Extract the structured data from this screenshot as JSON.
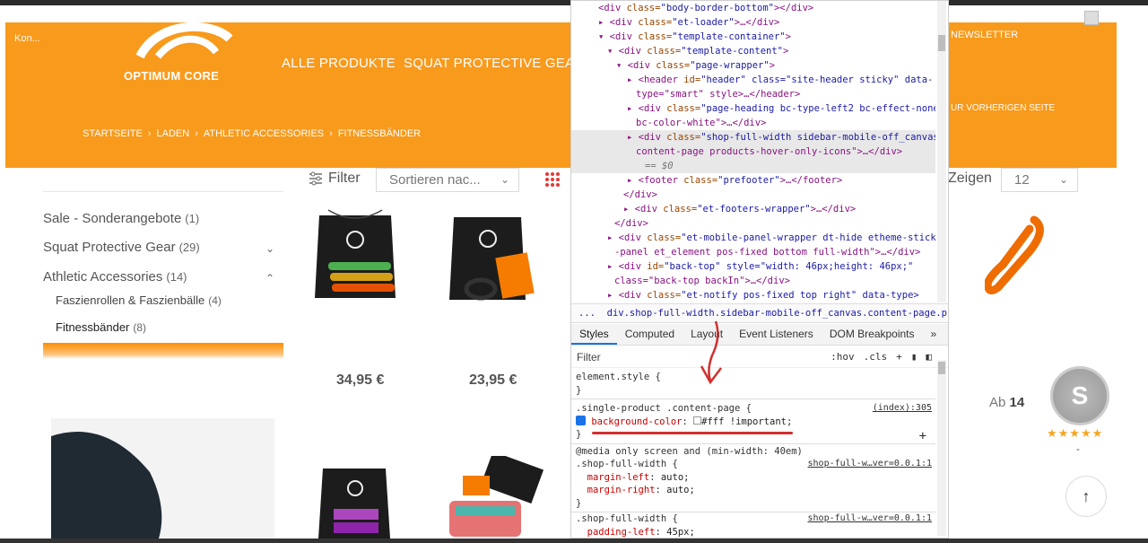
{
  "header": {
    "logo_text": "OPTIMUM CORE",
    "nav": [
      "ALLE PRODUKTE",
      "SQUAT PROTECTIVE GEAR"
    ],
    "top_left_small": "Kon...",
    "top_right_small": "...",
    "newsletter": "NEWSLETTER",
    "back_link": "UR VORHERIGEN SEITE",
    "breadcrumbs": [
      "STARTSEITE",
      "LADEN",
      "ATHLETIC ACCESSORIES",
      "FITNESSBÄNDER"
    ],
    "breadcrumb_sep": "›"
  },
  "sidebar": {
    "categories": [
      {
        "label": "Sale - Sonderangebote",
        "count": "(1)"
      },
      {
        "label": "Squat Protective Gear",
        "count": "(29)"
      },
      {
        "label": "Athletic Accessories",
        "count": "(14)"
      }
    ],
    "subcategories": [
      {
        "label": "Faszienrollen & Faszienbälle",
        "count": "(4)"
      },
      {
        "label": "Fitnessbänder",
        "count": "(8)"
      }
    ]
  },
  "toolbar": {
    "filter_label": "Filter",
    "sort_placeholder": "Sortieren nac...",
    "show_label": "Zeigen",
    "show_value": "12"
  },
  "products": {
    "prices": [
      "34,95 €",
      "23,95 €"
    ],
    "ab_price_prefix": "Ab",
    "ab_price_value": "14"
  },
  "badge": {
    "letter": "S",
    "stars": "★★★★★",
    "dash": "-"
  },
  "devtools": {
    "tree_lines": [
      {
        "pre": "<div ",
        "attr": "class",
        "val": "\"body-border-bottom\"",
        "post": "></div>"
      },
      {
        "pre": "▸ <div ",
        "attr": "class",
        "val": "\"et-loader\"",
        "post": ">…</div>"
      },
      {
        "pre": "▾ <div ",
        "attr": "class",
        "val": "\"template-container\"",
        "post": ">"
      },
      {
        "pre": "▾ <div ",
        "attr": "class",
        "val": "\"template-content\"",
        "post": ">"
      },
      {
        "pre": "▾ <div ",
        "attr": "class",
        "val": "\"page-wrapper\"",
        "post": ">"
      },
      {
        "pre": "▸ <header ",
        "attr": "id",
        "val": "\"header\" class=\"site-header sticky\" data-",
        "post": ""
      },
      {
        "pre": "type=\"smart\" style>…</header>",
        "attr": "",
        "val": "",
        "post": ""
      },
      {
        "pre": "▸ <div ",
        "attr": "class",
        "val": "\"page-heading bc-type-left2 bc-effect-none",
        "post": ""
      },
      {
        "pre": "bc-color-white\">…</div>",
        "attr": "",
        "val": "",
        "post": ""
      },
      {
        "pre": "▸ <div ",
        "attr": "class",
        "val": "\"shop-full-width sidebar-mobile-off_canvas",
        "post": ""
      },
      {
        "pre": "content-page  products-hover-only-icons\">…</div>",
        "attr": "",
        "val": "",
        "post": ""
      },
      {
        "pre": "== $0",
        "attr": "",
        "val": "",
        "post": ""
      },
      {
        "pre": "▸ <footer ",
        "attr": "class",
        "val": "\"prefooter\"",
        "post": ">…</footer>"
      },
      {
        "pre": "</div>",
        "attr": "",
        "val": "",
        "post": ""
      },
      {
        "pre": "▸ <div ",
        "attr": "class",
        "val": "\"et-footers-wrapper\"",
        "post": ">…</div>"
      },
      {
        "pre": "</div>",
        "attr": "",
        "val": "",
        "post": ""
      },
      {
        "pre": "▸ <div ",
        "attr": "class",
        "val": "\"et-mobile-panel-wrapper dt-hide etheme-sticky",
        "post": ""
      },
      {
        "pre": "-panel et_element pos-fixed bottom full-width\">…</div>",
        "attr": "",
        "val": "",
        "post": ""
      },
      {
        "pre": "▸ <div ",
        "attr": "id",
        "val": "\"back-top\" style=\"width: 46px;height: 46px;\"",
        "post": ""
      },
      {
        "pre": "class=\"back-top backIn\">…</div>",
        "attr": "",
        "val": "",
        "post": ""
      },
      {
        "pre": "▸ <div ",
        "attr": "class",
        "val": "\"et-notify pos-fixed top right\" data-type>",
        "post": ""
      }
    ],
    "selected_crumb": "div.shop-full-width.sidebar-mobile-off_canvas.content-page.products-h",
    "tabs": [
      "Styles",
      "Computed",
      "Layout",
      "Event Listeners",
      "DOM Breakpoints",
      "»"
    ],
    "filter_placeholder": "Filter",
    "filter_tools": [
      ":hov",
      ".cls",
      "+"
    ],
    "rules": {
      "element_style": "element.style {",
      "close": "}",
      "r1_selector": ".single-product .content-page {",
      "r1_source": "(index):305",
      "r1_prop": "background-color",
      "r1_val": "#fff !important;",
      "media": "@media only screen and (min-width: 40em)",
      "r2_selector": ".shop-full-width {",
      "r2_source": "shop-full-w…ver=0.0.1:1",
      "r2_p1": "margin-left",
      "r2_v1": "auto;",
      "r2_p2": "margin-right",
      "r2_v2": "auto;",
      "r3_selector": ".shop-full-width {",
      "r3_source": "shop-full-w…ver=0.0.1:1",
      "r3_p1": "padding-left",
      "r3_v1": "45px;"
    },
    "dots": "..."
  },
  "colors": {
    "brand_orange": "#f89a1c",
    "accent_red": "#d32f2f",
    "devtools_blue": "#1a73e8"
  }
}
